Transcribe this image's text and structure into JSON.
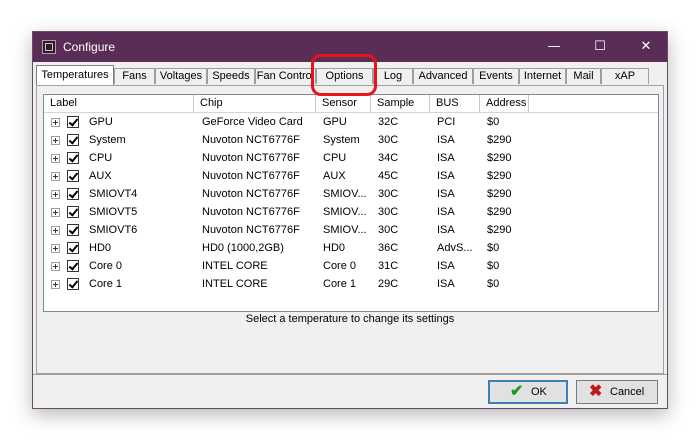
{
  "window": {
    "title": "Configure",
    "minimize": "—",
    "maximize": "☐",
    "close": "✕"
  },
  "tabs": [
    {
      "label": "Temperatures"
    },
    {
      "label": "Fans"
    },
    {
      "label": "Voltages"
    },
    {
      "label": "Speeds"
    },
    {
      "label": "Fan Control"
    },
    {
      "label": "Options"
    },
    {
      "label": "Log"
    },
    {
      "label": "Advanced"
    },
    {
      "label": "Events"
    },
    {
      "label": "Internet"
    },
    {
      "label": "Mail"
    },
    {
      "label": "xAP"
    }
  ],
  "columns": [
    "Label",
    "Chip",
    "Sensor",
    "Sample",
    "BUS",
    "Address"
  ],
  "rows": [
    {
      "label": "GPU",
      "chip": "GeForce Video Card",
      "sensor": "GPU",
      "sample": "32C",
      "bus": "PCI",
      "address": "$0"
    },
    {
      "label": "System",
      "chip": "Nuvoton NCT6776F",
      "sensor": "System",
      "sample": "30C",
      "bus": "ISA",
      "address": "$290"
    },
    {
      "label": "CPU",
      "chip": "Nuvoton NCT6776F",
      "sensor": "CPU",
      "sample": "34C",
      "bus": "ISA",
      "address": "$290"
    },
    {
      "label": "AUX",
      "chip": "Nuvoton NCT6776F",
      "sensor": "AUX",
      "sample": "45C",
      "bus": "ISA",
      "address": "$290"
    },
    {
      "label": "SMIOVT4",
      "chip": "Nuvoton NCT6776F",
      "sensor": "SMIOV...",
      "sample": "30C",
      "bus": "ISA",
      "address": "$290"
    },
    {
      "label": "SMIOVT5",
      "chip": "Nuvoton NCT6776F",
      "sensor": "SMIOV...",
      "sample": "30C",
      "bus": "ISA",
      "address": "$290"
    },
    {
      "label": "SMIOVT6",
      "chip": "Nuvoton NCT6776F",
      "sensor": "SMIOV...",
      "sample": "30C",
      "bus": "ISA",
      "address": "$290"
    },
    {
      "label": "HD0",
      "chip": "HD0 (1000,2GB)",
      "sensor": "HD0",
      "sample": "36C",
      "bus": "AdvS...",
      "address": "$0"
    },
    {
      "label": "Core 0",
      "chip": "INTEL CORE",
      "sensor": "Core 0",
      "sample": "31C",
      "bus": "ISA",
      "address": "$0"
    },
    {
      "label": "Core 1",
      "chip": "INTEL CORE",
      "sensor": "Core 1",
      "sample": "29C",
      "bus": "ISA",
      "address": "$0"
    }
  ],
  "hint": "Select a temperature to change its settings",
  "buttons": {
    "ok": "OK",
    "cancel": "Cancel"
  },
  "colors": {
    "titlebar": "#5a2d56",
    "highlight": "#e8141c",
    "ok_icon": "#1f9a1f",
    "cancel_icon": "#c01818"
  }
}
